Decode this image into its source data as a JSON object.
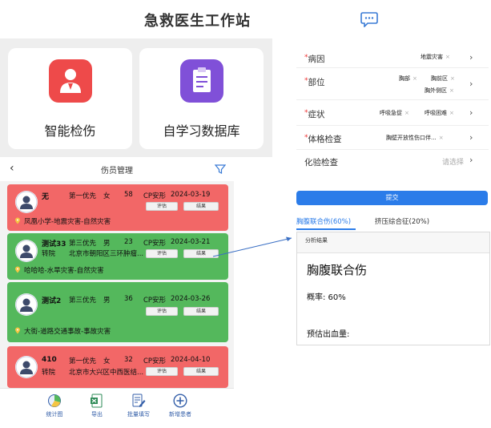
{
  "header": {
    "title": "急救医生工作站",
    "chat_icon": "chat-bubble-icon"
  },
  "features": [
    {
      "label": "智能检伤",
      "icon": "triage-doctor-icon",
      "color": "#ee4a4a"
    },
    {
      "label": "自学习数据库",
      "icon": "clipboard-icon",
      "color": "#8050d8"
    }
  ],
  "list": {
    "title": "伤员管理",
    "patients": [
      {
        "name": "无",
        "priority": "第一优先",
        "gender": "女",
        "age": "58",
        "cp": "CP安形",
        "date": "2024-03-19",
        "transfer": "",
        "address": "",
        "disaster": "凤凰小学-地震灾害-自然灾害",
        "btn_eval": "评估",
        "btn_result": "结果"
      },
      {
        "name": "测试33",
        "priority": "第三优先",
        "gender": "男",
        "age": "23",
        "cp": "CP安形",
        "date": "2024-03-21",
        "transfer": "转院",
        "address": "北京市朝阳区三环肿瘤...",
        "disaster": "哈哈哈-水旱灾害-自然灾害",
        "btn_eval": "评估",
        "btn_result": "结果"
      },
      {
        "name": "测试2",
        "priority": "第三优先",
        "gender": "男",
        "age": "36",
        "cp": "CP安形",
        "date": "2024-03-26",
        "transfer": "",
        "address": "",
        "disaster": "大街-道路交通事故-事故灾害",
        "btn_eval": "评估",
        "btn_result": "结果"
      },
      {
        "name": "410",
        "priority": "第一优先",
        "gender": "女",
        "age": "32",
        "cp": "CP安形",
        "date": "2024-04-10",
        "transfer": "转院",
        "address": "北京市大兴区中西医结...",
        "disaster": "",
        "btn_eval": "评估",
        "btn_result": "结果"
      }
    ],
    "tabs": [
      {
        "label": "统计图",
        "icon": "pie-chart-icon"
      },
      {
        "label": "导出",
        "icon": "excel-export-icon"
      },
      {
        "label": "批量填写",
        "icon": "batch-edit-icon"
      },
      {
        "label": "新增患者",
        "icon": "add-circle-icon"
      }
    ]
  },
  "form": {
    "fields": [
      {
        "label": "病因",
        "required": "*",
        "tags": [
          "地震灾害"
        ]
      },
      {
        "label": "部位",
        "required": "*",
        "tags": [
          "胸部",
          "胸前区",
          "胸外侧区"
        ]
      },
      {
        "label": "症状",
        "required": "*",
        "tags": [
          "呼吸急促",
          "呼吸困难"
        ]
      },
      {
        "label": "体格检查",
        "required": "*",
        "tags": [
          "胸壁开放性伤口伴..."
        ]
      },
      {
        "label": "化验检查",
        "required": "",
        "placeholder": "请选择"
      }
    ],
    "tag_close": "×",
    "submit_label": "提交"
  },
  "result": {
    "tabs": [
      {
        "label": "胸腹联合伤(60%)"
      },
      {
        "label": "挤压综合征(20%)"
      }
    ],
    "header_label": "分析结果",
    "title": "胸腹联合伤",
    "probability": "概率:  60%",
    "blood_loss": "预估出血量:"
  },
  "colors": {
    "red_card": "#f26767",
    "green_card": "#54b85c",
    "accent": "#2b7ce9"
  }
}
